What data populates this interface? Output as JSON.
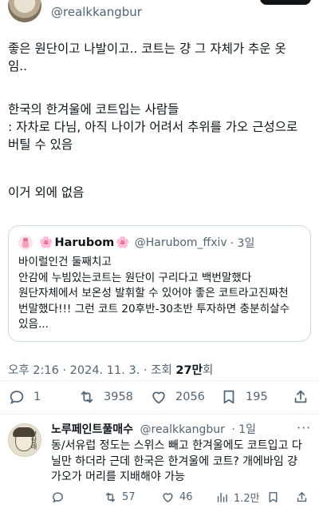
{
  "header": {
    "handle": "@realkkangbur"
  },
  "tweet": {
    "text_line1": "좋은 원단이고 나발이고.. 코트는 걍 그 자체가 추운 옷\n임..",
    "text_line2": "한국의 한겨울에 코트입는 사람들\n: 자차로 다님, 아직 나이가 어려서 추위를 가오 근성으로\n버틸 수 있음",
    "text_line3": "이거 외에 없음"
  },
  "quote": {
    "name": "Harubom",
    "name_decoration": "🌸",
    "handle": "@Harubom_ffxiv",
    "time": "· 3일",
    "body": "바이럴인건 둘째치고\n안감에 누빔있는코트는 원단이 구리다고 백번말했다\n원단자체에서 보온성 발휘할 수 있어야 좋은 코트라고진짜천\n번말했다!!! 그런 코트 20후반-30초반 투자하면 충분히살수\n있음..."
  },
  "meta": {
    "timestamp": "오후 2:16 · 2024. 11. 3. · 조회 ",
    "views_count": "27만",
    "views_suffix": "회"
  },
  "actions": {
    "replies": "1",
    "retweets": "3958",
    "likes": "2056",
    "bookmarks": "195"
  },
  "reply": {
    "name": "노루페인트풀매수",
    "handle": "@realkkangbur",
    "time": "· 1일",
    "more": "···",
    "avatar_text": "안살래",
    "body": "동/서유럽 정도는 스위스 빼고 한겨울에도 코트입고 다\n닐만 하더라 근데 한국은 한겨울에 코트? 개에바임 걍\n가오가 머리를 지배해야 가능",
    "replies": "",
    "retweets": "57",
    "likes": "46",
    "views": "1.2만"
  },
  "icons": {
    "reply": "reply-icon",
    "retweet": "retweet-icon",
    "like": "heart-icon",
    "bookmark": "bookmark-icon",
    "share": "share-icon",
    "views": "views-icon"
  },
  "colors": {
    "text_primary": "#0f1419",
    "text_secondary": "#536471",
    "border": "#cfd9de",
    "divider": "#eff3f4"
  }
}
